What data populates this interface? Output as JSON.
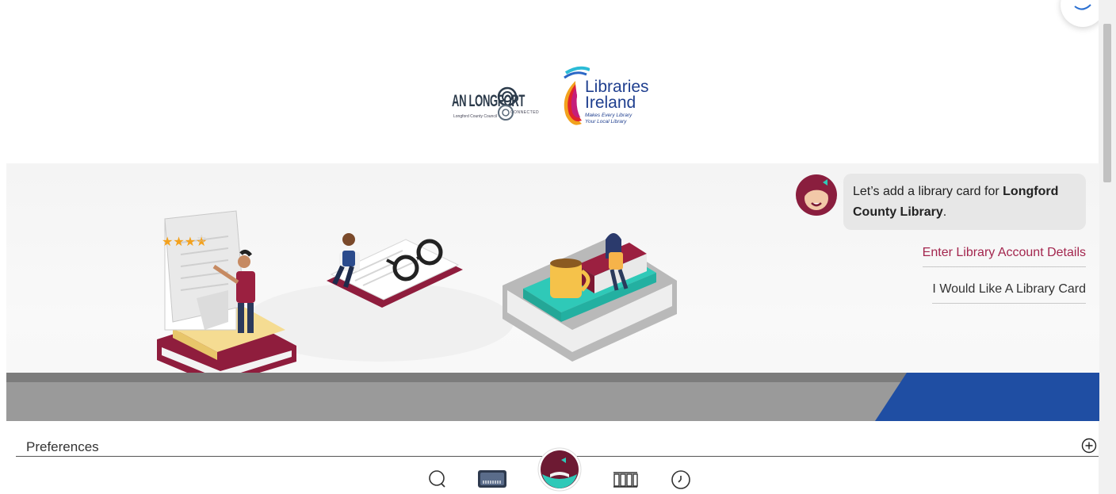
{
  "logos": {
    "council": {
      "wordmark": "AN LONGFORT",
      "sub": "Longford County Council",
      "sub2": "CONNECTED"
    },
    "libraries_ireland": {
      "line1": "Libraries",
      "line2": "Ireland",
      "tagline1": "Makes Every Library",
      "tagline2": "Your Local Library"
    }
  },
  "chat": {
    "message_prefix": "Let’s add a library card for ",
    "library_name": "Longford County Library",
    "message_suffix": ".",
    "options": [
      {
        "label": "Enter Library Account Details"
      },
      {
        "label": "I Would Like A Library Card"
      }
    ]
  },
  "illustration": {
    "rating_stars": 4,
    "rating_max": 5
  },
  "preferences": {
    "label": "Preferences"
  },
  "nav": {
    "items": [
      "search-icon",
      "shelf-icon",
      "home-icon",
      "library-icon",
      "recent-icon"
    ]
  },
  "colors": {
    "accent": "#a3264e",
    "brand_blue": "#1f4ea3",
    "teal": "#2fc9b8",
    "band_gray": "#9a9a9a"
  }
}
